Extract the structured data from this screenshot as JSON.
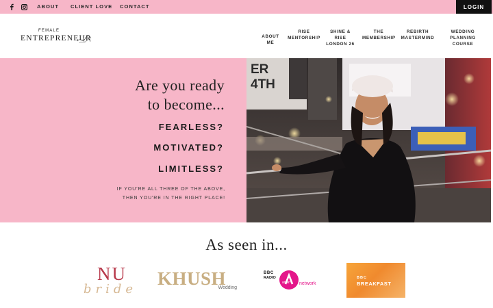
{
  "topbar": {
    "nav": [
      {
        "label": "ABOUT"
      },
      {
        "label": "CLIENT LOVE"
      },
      {
        "label": "CONTACT"
      }
    ],
    "login_label": "LOGIN",
    "social": [
      "facebook-icon",
      "instagram-icon"
    ],
    "bg_color": "#f7b6c8"
  },
  "logo": {
    "small": "FEMALE",
    "main": "ENTREPRENEUR"
  },
  "mainnav": [
    {
      "label": "ABOUT ME"
    },
    {
      "label": "RISE\nMENTORSHIP"
    },
    {
      "label": "SHINE & RISE\nLONDON 26"
    },
    {
      "label": "THE\nMEMBERSHIP"
    },
    {
      "label": "REBIRTH\nMASTERMIND"
    },
    {
      "label": "WEDDING\nPLANNING COURSE"
    }
  ],
  "hero": {
    "line1": "Are you ready",
    "line2": "to become...",
    "words": [
      "FEARLESS?",
      "MOTIVATED?",
      "LIMITLESS?"
    ],
    "sub1": "IF YOU'RE ALL THREE OF THE ABOVE,",
    "sub2": "THEN YOU'RE IN THE RIGHT PLACE!",
    "photo_sign_1": "ER",
    "photo_sign_2": "4TH",
    "accent_color": "#f7b6c8"
  },
  "seen": {
    "title": "As seen in...",
    "logos": {
      "nu": {
        "top": "NU",
        "bottom": "bride"
      },
      "khush": {
        "main": "KHUSH",
        "sub": "Wedding"
      },
      "bbc_radio": {
        "bbc": "BBC",
        "radio": "RADIO",
        "asian": "asian",
        "network": "network"
      },
      "bbc_breakfast": {
        "bbc": "BBC",
        "breakfast": "BREAKFAST"
      }
    }
  }
}
